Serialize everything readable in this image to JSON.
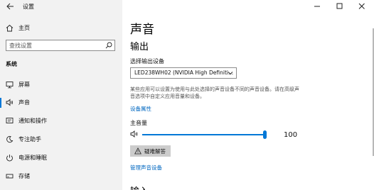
{
  "window": {
    "title": "设置",
    "controls": [
      "minimize-icon",
      "maximize-icon",
      "close-icon"
    ]
  },
  "sidebar": {
    "home_label": "主页",
    "search_placeholder": "查找设置",
    "section_label": "系统",
    "items": [
      {
        "label": "屏幕",
        "icon": "display-icon",
        "active": false
      },
      {
        "label": "声音",
        "icon": "speaker-icon",
        "active": true
      },
      {
        "label": "通知和操作",
        "icon": "notification-icon",
        "active": false
      },
      {
        "label": "专注助手",
        "icon": "focus-moon-icon",
        "active": false
      },
      {
        "label": "电源和睡眠",
        "icon": "power-icon",
        "active": false
      },
      {
        "label": "存储",
        "icon": "storage-icon",
        "active": false
      }
    ]
  },
  "main": {
    "page_title": "声音",
    "output_title": "输出",
    "device_label": "选择输出设备",
    "device_value": "LED238WH02 (NVIDIA High Definiti...",
    "info_text": "某些应用可以设置为使用与此处选择的声音设备不同的声音设备。请在高级声音选项中自定义应用音量和设备。",
    "device_properties_link": "设备属性",
    "volume_label": "主音量",
    "volume_value": "100",
    "volume_fraction": 1.0,
    "troubleshoot_label": "疑难解答",
    "manage_devices_link": "管理声音设备",
    "input_title": "输入"
  },
  "colors": {
    "accent": "#0078d7",
    "link": "#0067c0",
    "sidebar_bg": "#f2f2f2"
  }
}
